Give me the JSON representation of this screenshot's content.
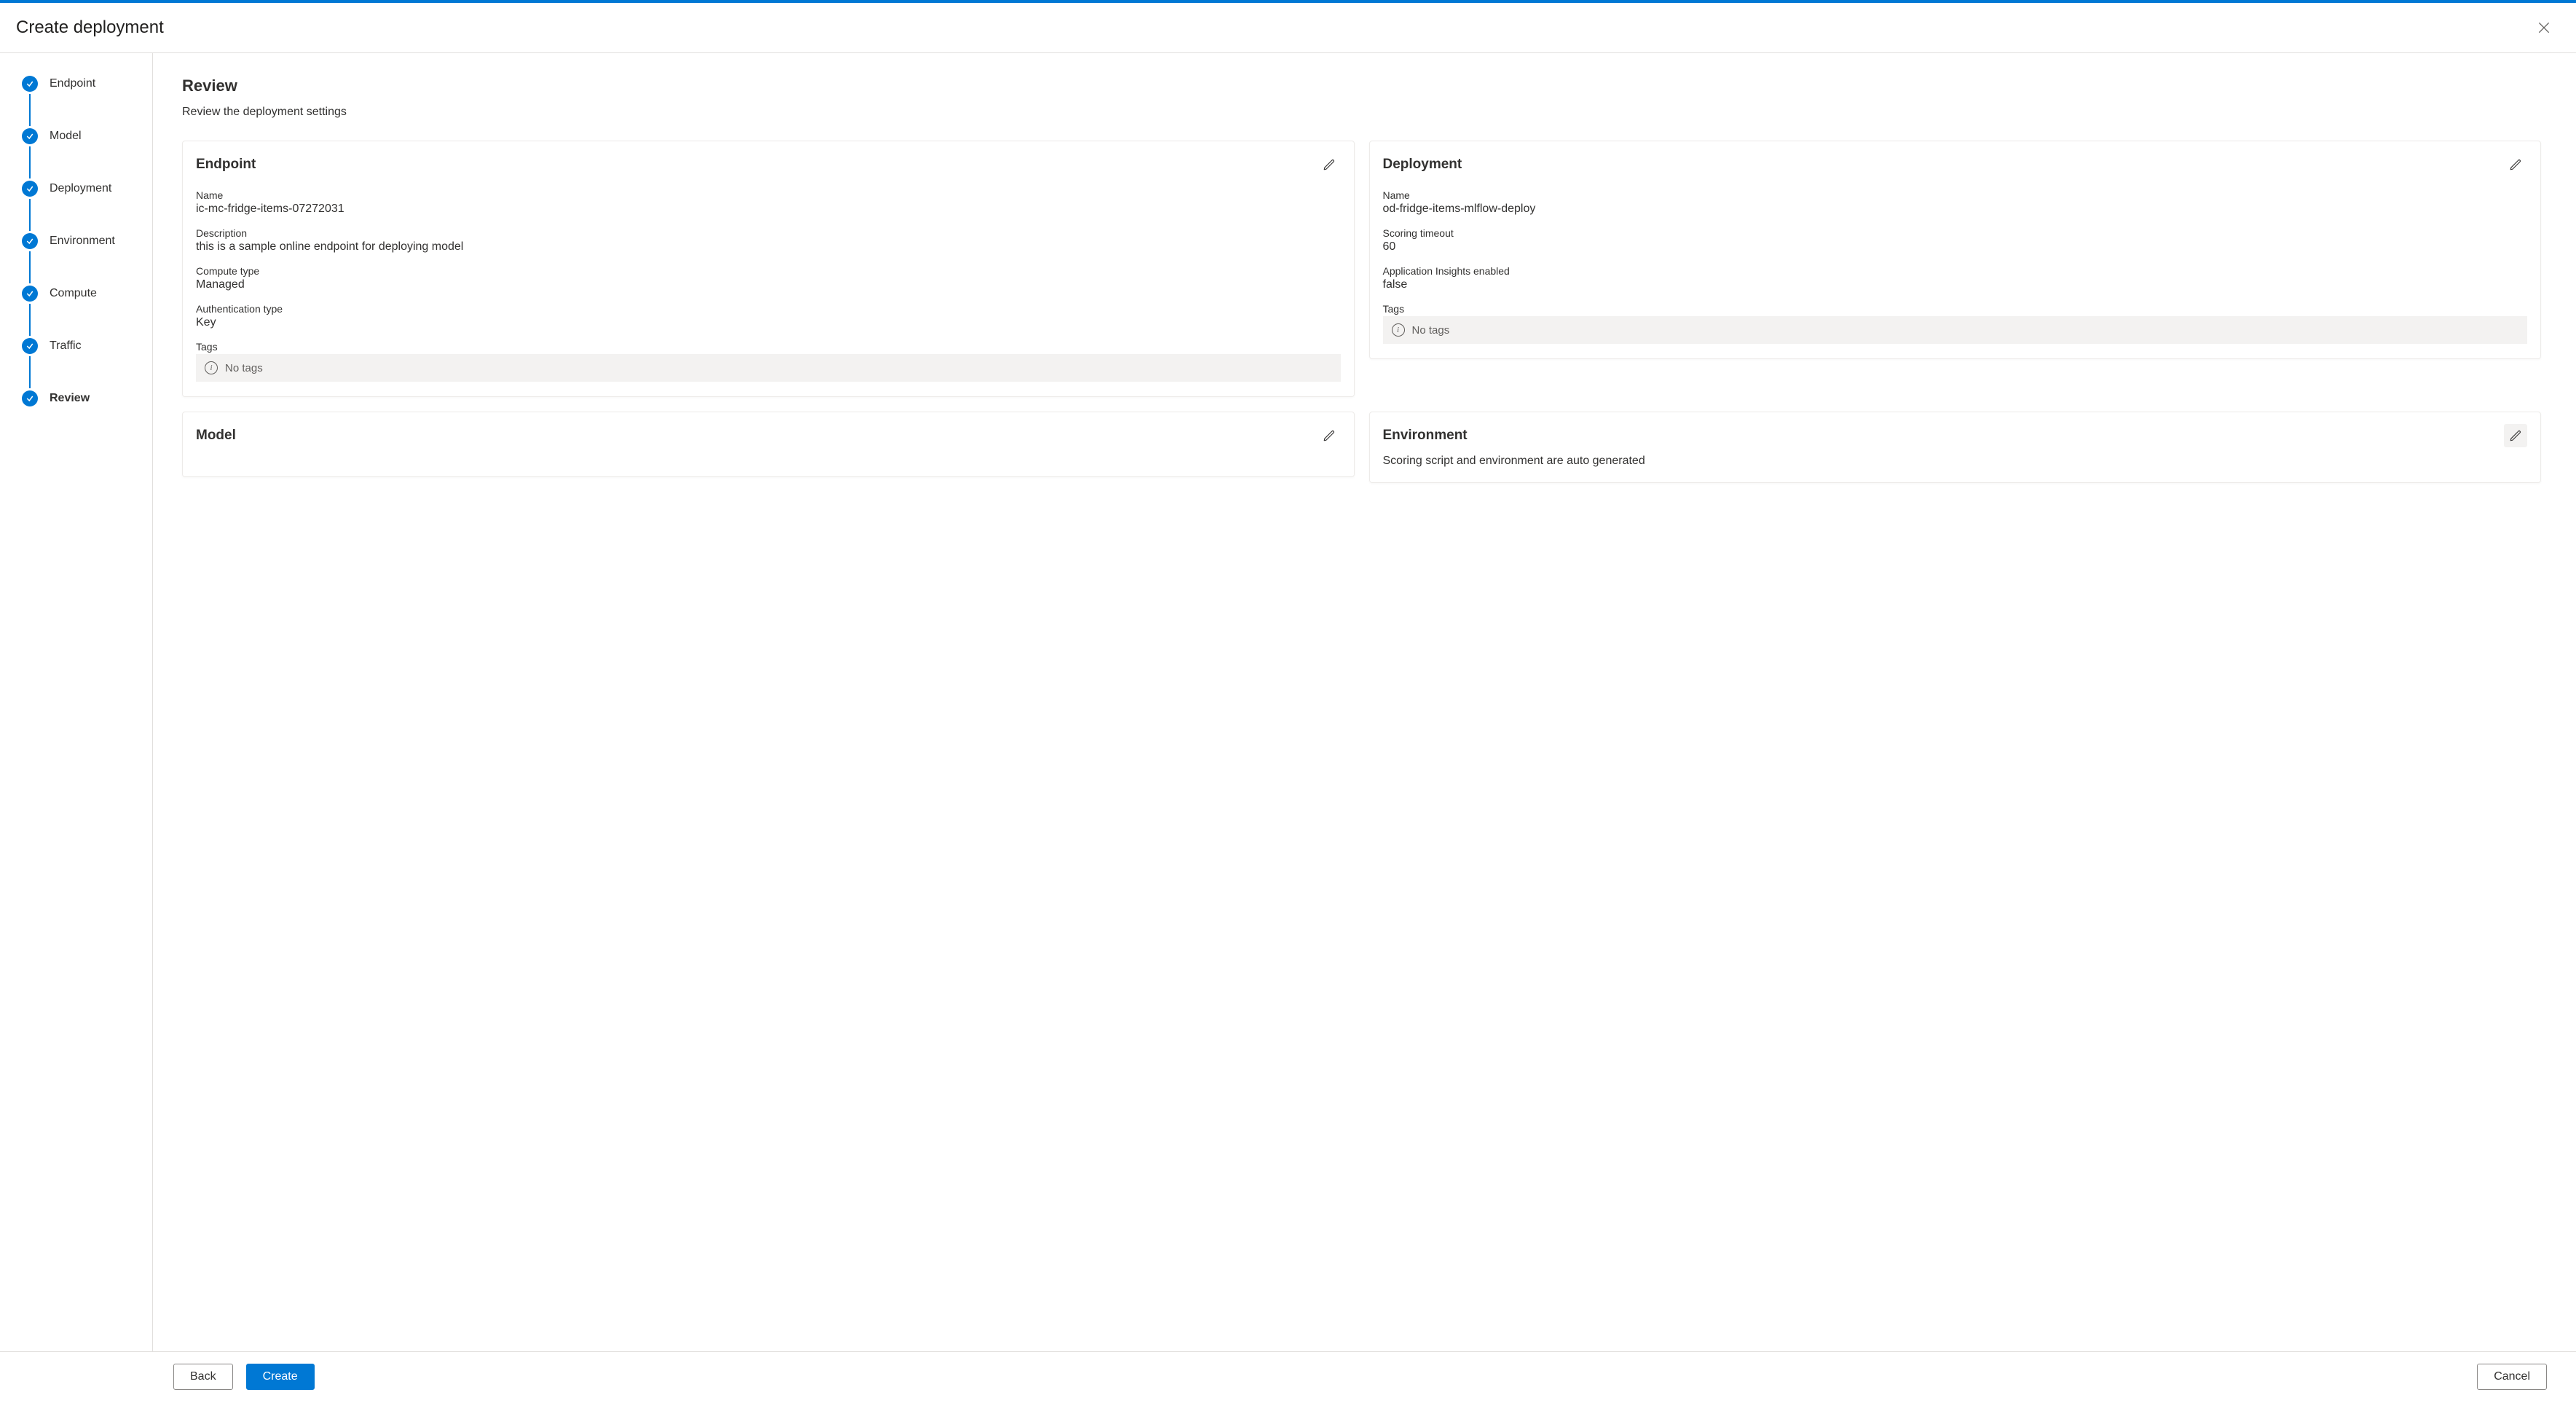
{
  "header": {
    "title": "Create deployment"
  },
  "steps": [
    {
      "label": "Endpoint",
      "state": "done"
    },
    {
      "label": "Model",
      "state": "done"
    },
    {
      "label": "Deployment",
      "state": "done"
    },
    {
      "label": "Environment",
      "state": "done"
    },
    {
      "label": "Compute",
      "state": "done"
    },
    {
      "label": "Traffic",
      "state": "done"
    },
    {
      "label": "Review",
      "state": "current"
    }
  ],
  "main": {
    "heading": "Review",
    "subtitle": "Review the deployment settings",
    "cards": {
      "endpoint": {
        "title": "Endpoint",
        "name_label": "Name",
        "name": "ic-mc-fridge-items-07272031",
        "description_label": "Description",
        "description": "this is a sample online endpoint for deploying model",
        "compute_type_label": "Compute type",
        "compute_type": "Managed",
        "auth_type_label": "Authentication type",
        "auth_type": "Key",
        "tags_label": "Tags",
        "tags_empty": "No tags"
      },
      "deployment": {
        "title": "Deployment",
        "name_label": "Name",
        "name": "od-fridge-items-mlflow-deploy",
        "scoring_timeout_label": "Scoring timeout",
        "scoring_timeout": "60",
        "app_insights_label": "Application Insights enabled",
        "app_insights": "false",
        "tags_label": "Tags",
        "tags_empty": "No tags"
      },
      "model": {
        "title": "Model"
      },
      "environment": {
        "title": "Environment",
        "text": "Scoring script and environment are auto generated"
      }
    }
  },
  "footer": {
    "back": "Back",
    "create": "Create",
    "cancel": "Cancel"
  }
}
